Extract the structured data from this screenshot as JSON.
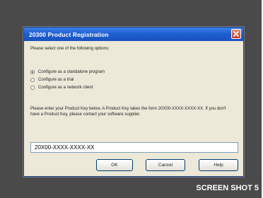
{
  "dialog": {
    "title": "20300 Product Registration",
    "prompt": "Please select one of the following options:",
    "options": [
      {
        "label": "Configure as a standalone program",
        "selected": true
      },
      {
        "label": "Configure as a trial",
        "selected": false
      },
      {
        "label": "Configure as a network client",
        "selected": false
      }
    ],
    "instructions": "Please enter your Product Key below. A Product Key takes the form 20X00-XXXX-XXXX-XX. If you don't have a Product Key, please contact your software supplier.",
    "key_input": {
      "value": "20X00-XXXX-XXXX-XX"
    },
    "buttons": {
      "ok": "OK",
      "cancel": "Cancel",
      "help": "Help"
    }
  },
  "caption": "SCREEN SHOT 5",
  "colors": {
    "background": "#4a4a4a",
    "titlebar": "#1f5fd1",
    "dialog_face": "#ece9d8",
    "close_button": "#c4401f"
  }
}
